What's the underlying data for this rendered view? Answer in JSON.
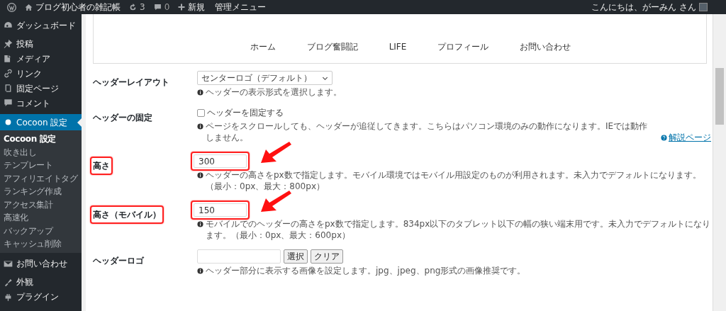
{
  "admin_bar": {
    "site_name": "ブログ初心者の雑記帳",
    "updates": "3",
    "comments": "0",
    "new": "新規",
    "admin_menu": "管理メニュー",
    "greeting": "こんにちは、がーみん さん"
  },
  "sidebar": {
    "items": [
      {
        "label": "ダッシュボード",
        "selected": false
      },
      {
        "label": "投稿",
        "selected": false
      },
      {
        "label": "メディア",
        "selected": false
      },
      {
        "label": "リンク",
        "selected": false
      },
      {
        "label": "固定ページ",
        "selected": false
      },
      {
        "label": "コメント",
        "selected": false
      },
      {
        "label": "Cocoon 設定",
        "selected": true,
        "children": [
          {
            "label": "Cocoon 設定",
            "selected": true
          },
          {
            "label": "吹き出し",
            "selected": false
          },
          {
            "label": "テンプレート",
            "selected": false
          },
          {
            "label": "アフィリエイトタグ",
            "selected": false
          },
          {
            "label": "ランキング作成",
            "selected": false
          },
          {
            "label": "アクセス集計",
            "selected": false
          },
          {
            "label": "高速化",
            "selected": false
          },
          {
            "label": "バックアップ",
            "selected": false
          },
          {
            "label": "キャッシュ削除",
            "selected": false
          }
        ]
      },
      {
        "label": "お問い合わせ",
        "selected": false
      },
      {
        "label": "外観",
        "selected": false
      },
      {
        "label": "プラグイン",
        "selected": false
      }
    ]
  },
  "preview_nav": [
    "ホーム",
    "ブログ奮闘記",
    "LIFE",
    "プロフィール",
    "お問い合わせ"
  ],
  "settings": [
    {
      "kind": "select",
      "label": "ヘッダーレイアウト",
      "value": "センターロゴ（デフォルト）",
      "hint": "ヘッダーの表示形式を選択します。",
      "highlighted": false
    },
    {
      "kind": "checkbox",
      "label": "ヘッダーの固定",
      "option": "ヘッダーを固定する",
      "checked": false,
      "hint": "ページをスクロールしても、ヘッダーが追従してきます。こちらはパソコン環境のみの動作になります。IEでは動作しません。",
      "link": "解説ページ",
      "highlighted": false
    },
    {
      "kind": "number",
      "label": "高さ",
      "value": "300",
      "hint": "ヘッダーの高さをpx数で指定します。モバイル環境ではモバイル用設定のものが利用されます。未入力でデフォルトになります。（最小：0px、最大：800px）",
      "highlighted": true
    },
    {
      "kind": "number",
      "label": "高さ（モバイル）",
      "value": "150",
      "hint": "モバイルでのヘッダーの高さをpx数で指定します。834px以下のタブレット以下の幅の狭い端末用です。未入力でデフォルトになります。（最小：0px、最大：600px）",
      "highlighted": true
    },
    {
      "kind": "image",
      "label": "ヘッダーロゴ",
      "buttons": [
        "選択",
        "クリア"
      ],
      "hint": "ヘッダー部分に表示する画像を設定します。jpg、jpeg、png形式の画像推奨です。",
      "highlighted": false
    }
  ]
}
